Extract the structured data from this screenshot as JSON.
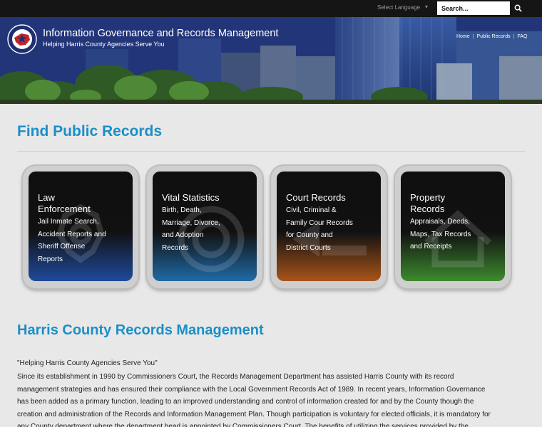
{
  "topbar": {
    "language_label": "Select Language",
    "search": {
      "placeholder": "Search..."
    }
  },
  "header": {
    "seal_icon": "harris-county-seal-icon",
    "title": "Information Governance and Records Management",
    "tagline": "Helping Harris County Agencies Serve You",
    "nav": [
      {
        "label": "Home"
      },
      {
        "label": "Public Records"
      },
      {
        "label": "FAQ"
      }
    ]
  },
  "find_records": {
    "heading": "Find Public Records",
    "cards": [
      {
        "title": "Law Enforcement",
        "title_lines": [
          "Law",
          "Enforcement"
        ],
        "lines": [
          "Jail Inmate Search,",
          "Accident Reports and",
          "Sheriff Offense",
          "Reports"
        ],
        "icon": "badge-icon",
        "accent": "#1f4a9c"
      },
      {
        "title": "Vital Statistics",
        "title_lines": [
          "Vital Statistics"
        ],
        "lines": [
          "Birth, Death,",
          "Marriage, Divorce,",
          "and Adoption",
          "Records"
        ],
        "icon": "circle-target-icon",
        "accent": "#1f6aa6"
      },
      {
        "title": "Court Records",
        "title_lines": [
          "Court Records"
        ],
        "lines": [
          "Civil, Criminal &",
          "Family Cour Records",
          "for County and",
          "District Courts"
        ],
        "icon": "gavel-icon",
        "accent": "#a9541a"
      },
      {
        "title": "Property Records",
        "title_lines": [
          "Property",
          "Records"
        ],
        "lines": [
          "Appraisals, Deeds,",
          "Maps, Tax Records",
          "and Receipts"
        ],
        "icon": "house-icon",
        "accent": "#3d8a2e"
      }
    ]
  },
  "about": {
    "heading": "Harris County Records Management",
    "quote": "\"Helping Harris County Agencies Serve You\"",
    "lines": [
      "Since its establishment in 1990 by Commissioners Court, the Records Management Department has assisted Harris County with its record",
      "management strategies and has ensured their compliance with the Local Government Records Act of 1989. In recent years, Information Governance",
      "has been added as a primary function, leading to an improved understanding and control of information created for and by the County though the",
      "creation and administration of the Records and Information Management Plan. Though participation is voluntary for elected officials, it is mandatory for",
      "any County department where the department head is appointed by Commissioners Court. The benefits of utilizing the services provided by the"
    ]
  }
}
